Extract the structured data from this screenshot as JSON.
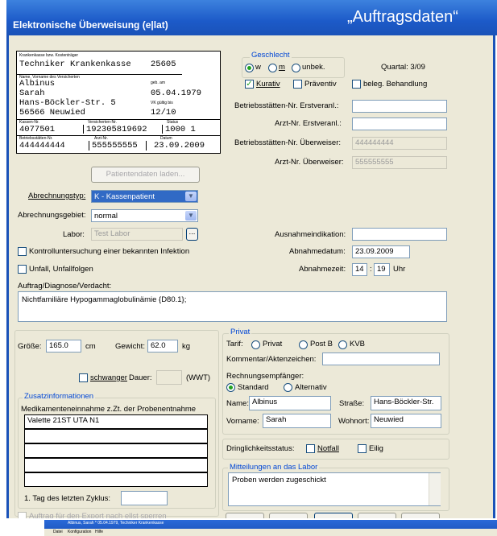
{
  "window": {
    "title": "Elektronische Überweisung (e|lat)",
    "badge": "„Auftragsdaten“"
  },
  "card": {
    "kasse_label": "Krankenkasse bzw. Kostenträger",
    "kasse": "Techniker Krankenkasse",
    "kasse_nr": "25605",
    "name_label": "Name, Vorname des Versicherten",
    "geb_label": "geb. am",
    "nachname": "Albinus",
    "vorname": "Sarah",
    "geb": "05.04.1979",
    "strasse": "Hans-Böckler-Str. 5",
    "vk_label": "VK gültig bis",
    "ort": "56566 Neuwied",
    "vk": "12/10",
    "kassennr_label": "Kassen-Nr.",
    "versnr_label": "Versicherten-Nr.",
    "status_label": "Status",
    "kassennr": "4077501",
    "versnr": "192305819692",
    "status": "1000 1",
    "bsnr_label": "Betriebsstätten-Nr.",
    "arzt_label": "Arzt-Nr.",
    "datum_label": "Datum",
    "bsnr": "444444444",
    "arztnr": "555555555",
    "datum": "23.09.2009"
  },
  "geschlecht": {
    "legend": "Geschlecht",
    "options": [
      "w",
      "m",
      "unbek."
    ],
    "selected": "w"
  },
  "quartal": "Quartal: 3/09",
  "checks": {
    "kurativ": "Kurativ",
    "praeventiv": "Präventiv",
    "beleg": "beleg. Behandlung"
  },
  "right_fields": {
    "bsnr_erst_label": "Betriebsstätten-Nr. Erstveranl.:",
    "bsnr_erst": "",
    "arzt_erst_label": "Arzt-Nr. Erstveranl.:",
    "arzt_erst": "",
    "bsnr_ueb_label": "Betriebsstätten-Nr. Überweiser:",
    "bsnr_ueb": "444444444",
    "arzt_ueb_label": "Arzt-Nr. Überweiser:",
    "arzt_ueb": "555555555"
  },
  "patient_btn": "Patientendaten laden...",
  "abrechnungstyp": {
    "label": "Abrechnungstyp:",
    "value": "K - Kassenpatient"
  },
  "abrechnungsgebiet": {
    "label": "Abrechnungsgebiet:",
    "value": "normal"
  },
  "labor": {
    "label": "Labor:",
    "value": "Test Labor",
    "browse": "..."
  },
  "ausnahme": {
    "label": "Ausnahmeindikation:",
    "value": ""
  },
  "abnahmedatum": {
    "label": "Abnahmedatum:",
    "value": "23.09.2009"
  },
  "abnahmezeit": {
    "label": "Abnahmezeit:",
    "hour": "14",
    "sep": ":",
    "minute": "19",
    "unit": "Uhr"
  },
  "kontroll": "Kontrolluntersuchung einer bekannten Infektion",
  "unfall": "Unfall, Unfallfolgen",
  "diagnose": {
    "label": "Auftrag/Diagnose/Verdacht:",
    "value": "Nichtfamiliäre Hypogammaglobulinämie {D80.1};"
  },
  "groesse": {
    "label": "Größe:",
    "value": "165.0",
    "unit": "cm"
  },
  "gewicht": {
    "label": "Gewicht:",
    "value": "62.0",
    "unit": "kg"
  },
  "schwanger": {
    "label": "schwanger",
    "dauer_label": "Dauer:",
    "dauer": "",
    "unit": "(WWT)"
  },
  "zusatz": {
    "legend": "Zusatzinformationen",
    "med_label": "Medikamenteneinnahme z.Zt. der Probenentnahme",
    "med_lines": [
      "Valette 21ST UTA N1",
      "",
      "",
      "",
      ""
    ],
    "zyklus_label": "1. Tag des letzten Zyklus:",
    "zyklus": ""
  },
  "privat": {
    "legend": "Privat",
    "tarif_label": "Tarif:",
    "tarif_options": [
      "Privat",
      "Post B",
      "KVB"
    ],
    "kommentar_label": "Kommentar/Aktenzeichen:",
    "kommentar": "",
    "empf_label": "Rechnungsempfänger:",
    "empf_options": [
      "Standard",
      "Alternativ"
    ],
    "name_label": "Name:",
    "name": "Albinus",
    "strasse_label": "Straße:",
    "strasse": "Hans-Böckler-Str.",
    "vorname_label": "Vorname:",
    "vorname": "Sarah",
    "wohnort_label": "Wohnort:",
    "wohnort": "Neuwied"
  },
  "dringlich": {
    "label": "Dringlichkeitsstatus:",
    "notfall": "Notfall",
    "eilig": "Eilig"
  },
  "mitteilungen": {
    "legend": "Mitteilungen an das Labor",
    "value": "Proben werden zugeschickt"
  },
  "export": "Auftrag für den Export nach ellst sperren",
  "taskbar": {
    "title": "Albinus, Sarah * 05.04.1979, Techniker Krankenkasse",
    "menu": [
      "Datei",
      "Konfiguration",
      "Hilfe"
    ]
  }
}
